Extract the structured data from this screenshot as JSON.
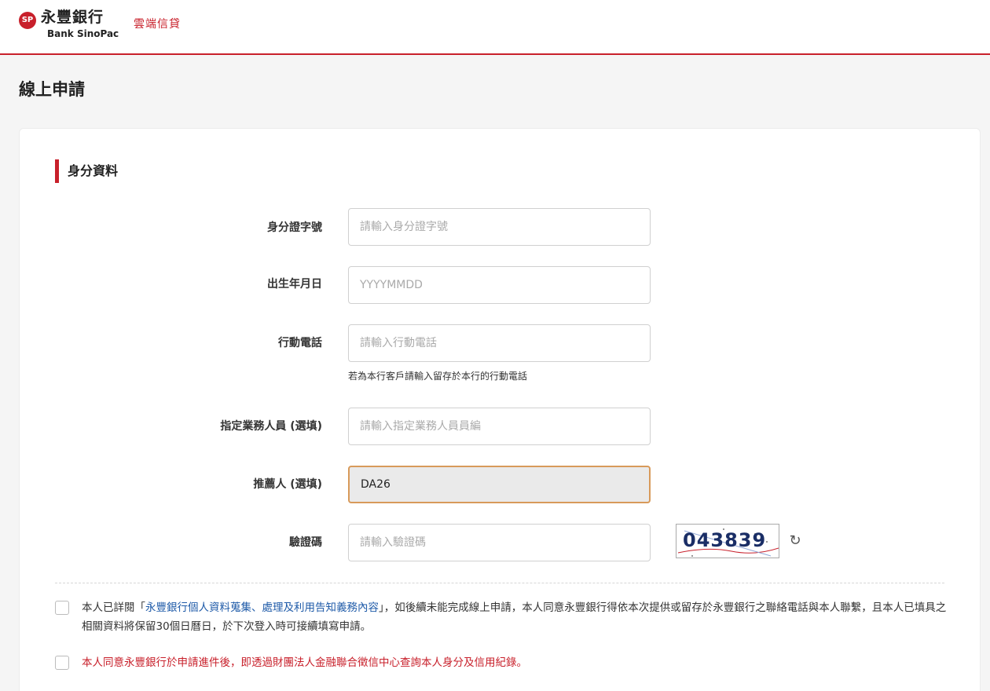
{
  "header": {
    "logo_mark": "SP",
    "brand_zh": "永豐銀行",
    "brand_en": "Bank SinoPac",
    "product": "雲端信貸"
  },
  "page": {
    "title": "線上申請"
  },
  "section": {
    "title": "身分資料"
  },
  "form": {
    "id_label": "身分證字號",
    "id_placeholder": "請輸入身分證字號",
    "birth_label": "出生年月日",
    "birth_placeholder": "YYYYMMDD",
    "phone_label": "行動電話",
    "phone_placeholder": "請輸入行動電話",
    "phone_hint": "若為本行客戶請輸入留存於本行的行動電話",
    "agent_label": "指定業務人員 (選填)",
    "agent_placeholder": "請輸入指定業務人員員編",
    "referrer_label": "推薦人 (選填)",
    "referrer_value": "DA26",
    "captcha_label": "驗證碼",
    "captcha_placeholder": "請輸入驗證碼",
    "captcha_text": "043839",
    "refresh_icon": "refresh-icon"
  },
  "consent": {
    "first_prefix": "本人已詳閱「",
    "first_link": "永豐銀行個人資料蒐集、處理及利用告知義務內容",
    "first_suffix": "」，如後續未能完成線上申請，本人同意永豐銀行得依本次提供或留存於永豐銀行之聯絡電話與本人聯繫，且本人已填具之相關資料將保留30個日曆日，於下次登入時可接續填寫申請。",
    "second": "本人同意永豐銀行於申請進件後，即透過財團法人金融聯合徵信中心查詢本人身分及信用紀錄。"
  },
  "colors": {
    "brand_red": "#c8202b",
    "link_blue": "#1e5aa8",
    "focus_border": "#d89a5a"
  }
}
